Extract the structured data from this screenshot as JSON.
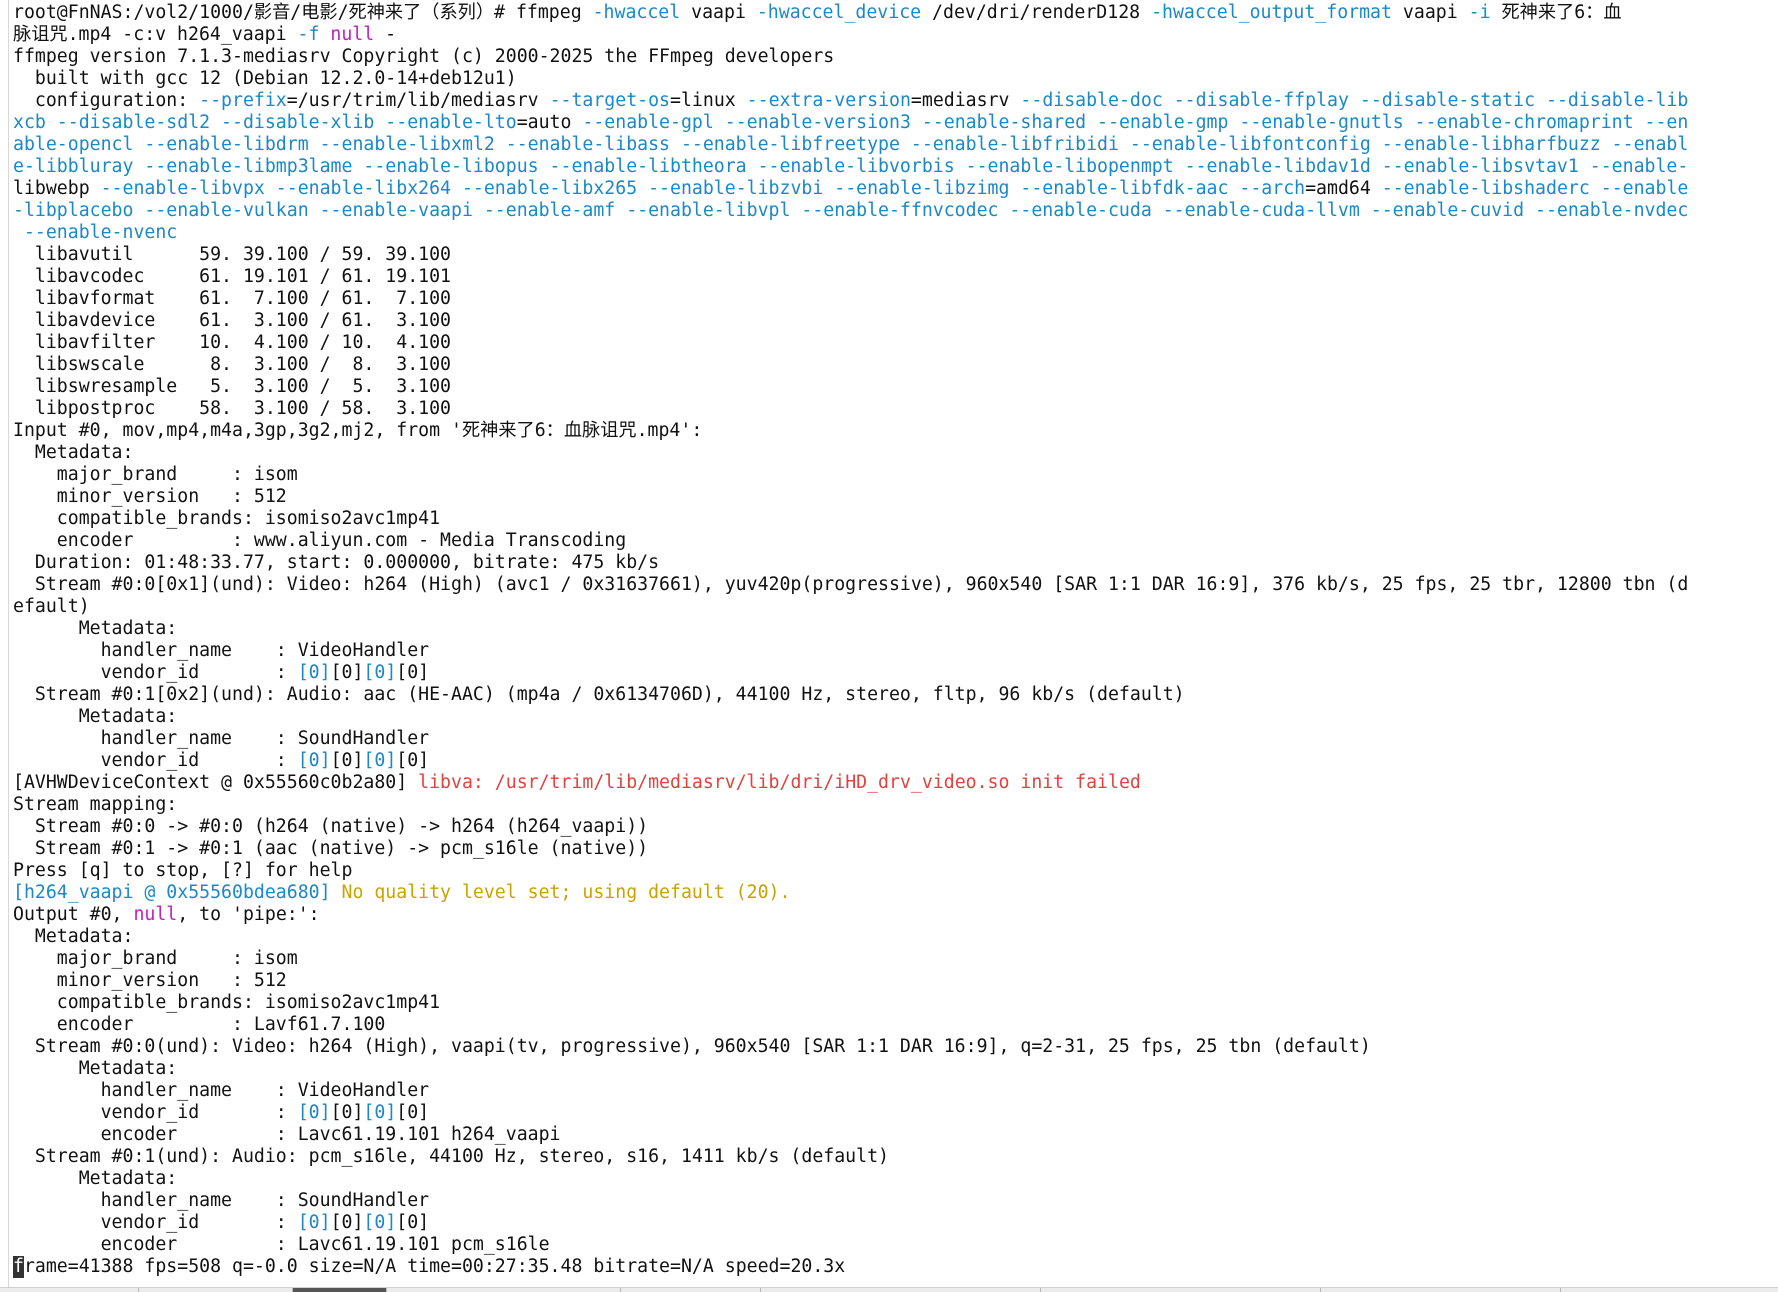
{
  "terminal": {
    "lines": [
      [
        [
          "d",
          "root@FnNAS:/vol2/1000/影音/电影/死神来了（系列）# ffmpeg "
        ],
        [
          "o",
          "-hwaccel"
        ],
        [
          "d",
          " vaapi "
        ],
        [
          "o",
          "-hwaccel_device"
        ],
        [
          "d",
          " /dev/dri/renderD128 "
        ],
        [
          "o",
          "-hwaccel_output_format"
        ],
        [
          "d",
          " vaapi "
        ],
        [
          "o",
          "-i"
        ],
        [
          "d",
          " 死神来了6：血"
        ]
      ],
      [
        [
          "d",
          "脉诅咒.mp4 -c:v h264_vaapi "
        ],
        [
          "o",
          "-f"
        ],
        [
          "d",
          " "
        ],
        [
          "n",
          "null"
        ],
        [
          "d",
          " -"
        ]
      ],
      [
        [
          "d",
          "ffmpeg version 7.1.3-mediasrv Copyright (c) 2000-2025 the FFmpeg developers"
        ]
      ],
      [
        [
          "d",
          "  built with gcc 12 (Debian 12.2.0-14+deb12u1)"
        ]
      ],
      [
        [
          "d",
          "  configuration: "
        ],
        [
          "o",
          "--prefix"
        ],
        [
          "d",
          "=/usr/trim/lib/mediasrv "
        ],
        [
          "o",
          "--target-os"
        ],
        [
          "d",
          "=linux "
        ],
        [
          "o",
          "--extra-version"
        ],
        [
          "d",
          "=mediasrv "
        ],
        [
          "o",
          "--disable-doc --disable-ffplay --disable-static --disable-lib"
        ]
      ],
      [
        [
          "o",
          "xcb --disable-sdl2 --disable-xlib --enable-lto"
        ],
        [
          "d",
          "=auto "
        ],
        [
          "o",
          "--enable-gpl --enable-version3 --enable-shared --enable-gmp --enable-gnutls --enable-chromaprint --en"
        ]
      ],
      [
        [
          "o",
          "able-opencl --enable-libdrm --enable-libxml2 --enable-libass --enable-libfreetype --enable-libfribidi --enable-libfontconfig --enable-libharfbuzz --enabl"
        ]
      ],
      [
        [
          "o",
          "e-libbluray --enable-libmp3lame --enable-libopus --enable-libtheora --enable-libvorbis --enable-libopenmpt --enable-libdav1d --enable-libsvtav1 --enable-"
        ]
      ],
      [
        [
          "d",
          "libwebp "
        ],
        [
          "o",
          "--enable-libvpx --enable-libx264 --enable-libx265 --enable-libzvbi --enable-libzimg --enable-libfdk-aac --arch"
        ],
        [
          "d",
          "=amd64 "
        ],
        [
          "o",
          "--enable-libshaderc --enable"
        ]
      ],
      [
        [
          "o",
          "-libplacebo --enable-vulkan --enable-vaapi --enable-amf --enable-libvpl --enable-ffnvcodec --enable-cuda --enable-cuda-llvm --enable-cuvid --enable-nvdec"
        ]
      ],
      [
        [
          "o",
          " --enable-nvenc"
        ]
      ],
      [
        [
          "d",
          "  libavutil      59. 39.100 / 59. 39.100"
        ]
      ],
      [
        [
          "d",
          "  libavcodec     61. 19.101 / 61. 19.101"
        ]
      ],
      [
        [
          "d",
          "  libavformat    61.  7.100 / 61.  7.100"
        ]
      ],
      [
        [
          "d",
          "  libavdevice    61.  3.100 / 61.  3.100"
        ]
      ],
      [
        [
          "d",
          "  libavfilter    10.  4.100 / 10.  4.100"
        ]
      ],
      [
        [
          "d",
          "  libswscale      8.  3.100 /  8.  3.100"
        ]
      ],
      [
        [
          "d",
          "  libswresample   5.  3.100 /  5.  3.100"
        ]
      ],
      [
        [
          "d",
          "  libpostproc    58.  3.100 / 58.  3.100"
        ]
      ],
      [
        [
          "d",
          "Input #0, mov,mp4,m4a,3gp,3g2,mj2, from '死神来了6：血脉诅咒.mp4':"
        ]
      ],
      [
        [
          "d",
          "  Metadata:"
        ]
      ],
      [
        [
          "d",
          "    major_brand     : isom"
        ]
      ],
      [
        [
          "d",
          "    minor_version   : 512"
        ]
      ],
      [
        [
          "d",
          "    compatible_brands: isomiso2avc1mp41"
        ]
      ],
      [
        [
          "d",
          "    encoder         : www.aliyun.com - Media Transcoding"
        ]
      ],
      [
        [
          "d",
          "  Duration: 01:48:33.77, start: 0.000000, bitrate: 475 kb/s"
        ]
      ],
      [
        [
          "d",
          "  Stream #0:0[0x1](und): Video: h264 (High) (avc1 / 0x31637661), yuv420p(progressive), 960x540 [SAR 1:1 DAR 16:9], 376 kb/s, 25 fps, 25 tbr, 12800 tbn (d"
        ]
      ],
      [
        [
          "d",
          "efault)"
        ]
      ],
      [
        [
          "d",
          "      Metadata:"
        ]
      ],
      [
        [
          "d",
          "        handler_name    : VideoHandler"
        ]
      ],
      [
        [
          "d",
          "        vendor_id       : "
        ],
        [
          "o",
          "[0]"
        ],
        [
          "d",
          "[0]"
        ],
        [
          "o",
          "[0]"
        ],
        [
          "d",
          "[0]"
        ]
      ],
      [
        [
          "d",
          "  Stream #0:1[0x2](und): Audio: aac (HE-AAC) (mp4a / 0x6134706D), 44100 Hz, stereo, fltp, 96 kb/s (default)"
        ]
      ],
      [
        [
          "d",
          "      Metadata:"
        ]
      ],
      [
        [
          "d",
          "        handler_name    : SoundHandler"
        ]
      ],
      [
        [
          "d",
          "        vendor_id       : "
        ],
        [
          "o",
          "[0]"
        ],
        [
          "d",
          "[0]"
        ],
        [
          "o",
          "[0]"
        ],
        [
          "d",
          "[0]"
        ]
      ],
      [
        [
          "d",
          "[AVHWDeviceContext @ 0x55560c0b2a80] "
        ],
        [
          "e",
          "libva: /usr/trim/lib/mediasrv/lib/dri/iHD_drv_video.so init failed"
        ]
      ],
      [
        [
          "d",
          "Stream mapping:"
        ]
      ],
      [
        [
          "d",
          "  Stream #0:0 -> #0:0 (h264 (native) -> h264 (h264_vaapi))"
        ]
      ],
      [
        [
          "d",
          "  Stream #0:1 -> #0:1 (aac (native) -> pcm_s16le (native))"
        ]
      ],
      [
        [
          "d",
          "Press [q] to stop, [?] for help"
        ]
      ],
      [
        [
          "c",
          "[h264_vaapi @ 0x55560bdea680] "
        ],
        [
          "w",
          "No quality level set; using default (20)."
        ]
      ],
      [
        [
          "d",
          "Output #0, "
        ],
        [
          "n",
          "null"
        ],
        [
          "d",
          ", to 'pipe:':"
        ]
      ],
      [
        [
          "d",
          "  Metadata:"
        ]
      ],
      [
        [
          "d",
          "    major_brand     : isom"
        ]
      ],
      [
        [
          "d",
          "    minor_version   : 512"
        ]
      ],
      [
        [
          "d",
          "    compatible_brands: isomiso2avc1mp41"
        ]
      ],
      [
        [
          "d",
          "    encoder         : Lavf61.7.100"
        ]
      ],
      [
        [
          "d",
          "  Stream #0:0(und): Video: h264 (High), vaapi(tv, progressive), 960x540 [SAR 1:1 DAR 16:9], q=2-31, 25 fps, 25 tbn (default)"
        ]
      ],
      [
        [
          "d",
          "      Metadata:"
        ]
      ],
      [
        [
          "d",
          "        handler_name    : VideoHandler"
        ]
      ],
      [
        [
          "d",
          "        vendor_id       : "
        ],
        [
          "o",
          "[0]"
        ],
        [
          "d",
          "[0]"
        ],
        [
          "o",
          "[0]"
        ],
        [
          "d",
          "[0]"
        ]
      ],
      [
        [
          "d",
          "        encoder         : Lavc61.19.101 h264_vaapi"
        ]
      ],
      [
        [
          "d",
          "  Stream #0:1(und): Audio: pcm_s16le, 44100 Hz, stereo, s16, 1411 kb/s (default)"
        ]
      ],
      [
        [
          "d",
          "      Metadata:"
        ]
      ],
      [
        [
          "d",
          "        handler_name    : SoundHandler"
        ]
      ],
      [
        [
          "d",
          "        vendor_id       : "
        ],
        [
          "o",
          "[0]"
        ],
        [
          "d",
          "[0]"
        ],
        [
          "o",
          "[0]"
        ],
        [
          "d",
          "[0]"
        ]
      ],
      [
        [
          "d",
          "        encoder         : Lavc61.19.101 pcm_s16le"
        ]
      ],
      [
        [
          "k",
          "f"
        ],
        [
          "d",
          "rame=41388 fps=508 q=-0.0 size=N/A time=00:27:35.48 bitrate=N/A speed=20.3x"
        ]
      ]
    ]
  },
  "colors": {
    "default": "#111111",
    "option": "#1b88c7",
    "null_keyword": "#c020c0",
    "error": "#e0433e",
    "warning": "#c9a300",
    "context_tag": "#1b88c7",
    "background": "#ffffff"
  }
}
